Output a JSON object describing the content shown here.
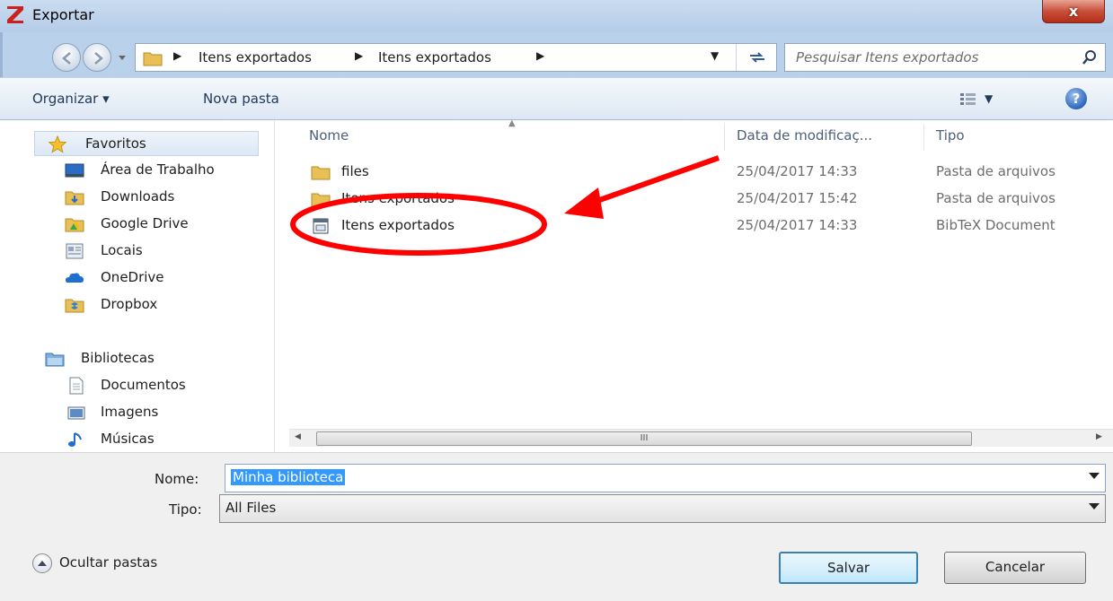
{
  "window": {
    "title": "Exportar",
    "close_label": "x"
  },
  "address": {
    "crumbs": [
      "Itens exportados",
      "Itens exportados"
    ],
    "search_placeholder": "Pesquisar Itens exportados"
  },
  "toolbar": {
    "organize_label": "Organizar ▾",
    "new_folder_label": "Nova pasta",
    "help_label": "?"
  },
  "sidebar": {
    "favorites_label": "Favoritos",
    "favorites": [
      {
        "label": "Área de Trabalho",
        "icon": "desktop-icon"
      },
      {
        "label": "Downloads",
        "icon": "downloads-folder-icon"
      },
      {
        "label": "Google Drive",
        "icon": "google-drive-folder-icon"
      },
      {
        "label": "Locais",
        "icon": "recent-places-icon"
      },
      {
        "label": "OneDrive",
        "icon": "onedrive-icon"
      },
      {
        "label": "Dropbox",
        "icon": "dropbox-icon"
      }
    ],
    "libraries_label": "Bibliotecas",
    "libraries": [
      {
        "label": "Documentos",
        "icon": "documents-icon"
      },
      {
        "label": "Imagens",
        "icon": "pictures-icon"
      },
      {
        "label": "Músicas",
        "icon": "music-icon"
      }
    ]
  },
  "files": {
    "columns": [
      "Nome",
      "Data de modificaç...",
      "Tipo"
    ],
    "rows": [
      {
        "name": "files",
        "date": "25/04/2017 14:33",
        "type": "Pasta de arquivos",
        "icon": "folder-icon"
      },
      {
        "name": "Itens exportados",
        "date": "25/04/2017 15:42",
        "type": "Pasta de arquivos",
        "icon": "folder-icon"
      },
      {
        "name": "Itens exportados",
        "date": "25/04/2017 14:33",
        "type": "BibTeX Document",
        "icon": "bibtex-file-icon"
      }
    ],
    "hscroll_grip": "III"
  },
  "form": {
    "name_label": "Nome:",
    "name_value": "Minha biblioteca",
    "type_label": "Tipo:",
    "type_value": "All Files",
    "hide_folders_label": "Ocultar pastas",
    "save_label": "Salvar",
    "cancel_label": "Cancelar"
  },
  "colors": {
    "annotation_red": "#ff0000",
    "selection_blue": "#3399ff",
    "chrome_blue": "#b9d1ea"
  }
}
